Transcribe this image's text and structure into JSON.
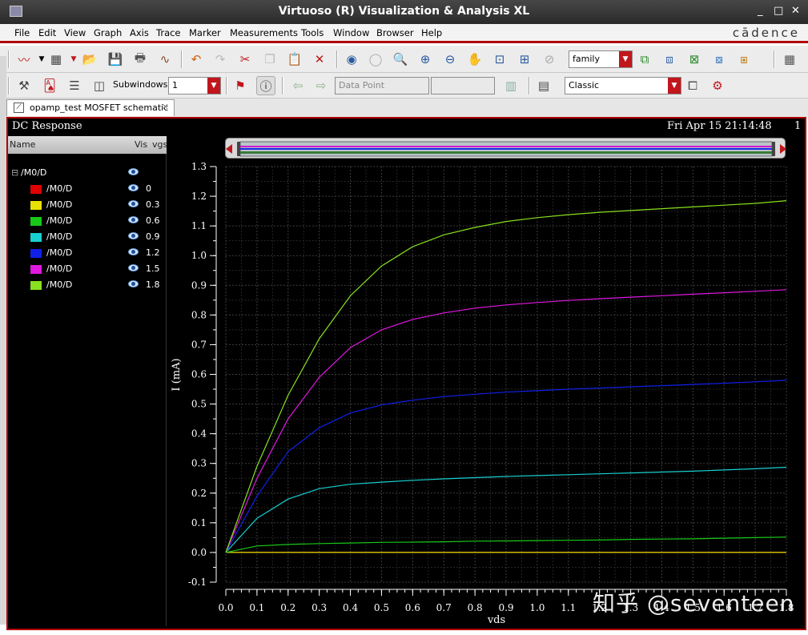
{
  "window": {
    "title": "Virtuoso (R) Visualization & Analysis XL",
    "brand": "cādence"
  },
  "menu": [
    "File",
    "Edit",
    "View",
    "Graph",
    "Axis",
    "Trace",
    "Marker",
    "Measurements",
    "Tools",
    "Window",
    "Browser",
    "Help"
  ],
  "toolbar": {
    "family_combo": "family",
    "subwindows_label": "Subwindows:",
    "subwindows_value": "1",
    "data_point_combo": "Data Point",
    "style_combo": "Classic"
  },
  "tab": {
    "label": "opamp_test MOSFET schematic"
  },
  "graph": {
    "header_title": "DC Response",
    "header_date": "Fri Apr 15 21:14:48",
    "subwindow_number": "1",
    "watermark": "知乎 @seventeen"
  },
  "legend": {
    "columns": [
      "Name",
      "Vis",
      "vgs"
    ],
    "group": "/M0/D",
    "rows": [
      {
        "name": "/M0/D",
        "vgs": "0",
        "color": "#e00000"
      },
      {
        "name": "/M0/D",
        "vgs": "0.3",
        "color": "#e8e000"
      },
      {
        "name": "/M0/D",
        "vgs": "0.6",
        "color": "#18c818"
      },
      {
        "name": "/M0/D",
        "vgs": "0.9",
        "color": "#18d0d0"
      },
      {
        "name": "/M0/D",
        "vgs": "1.2",
        "color": "#1020e8"
      },
      {
        "name": "/M0/D",
        "vgs": "1.5",
        "color": "#e018e0"
      },
      {
        "name": "/M0/D",
        "vgs": "1.8",
        "color": "#88e020"
      }
    ]
  },
  "chart_data": {
    "type": "line",
    "xlabel": "vds",
    "ylabel": "I (mA)",
    "xlim": [
      0,
      1.8
    ],
    "ylim": [
      -0.1,
      1.3
    ],
    "xticks": [
      "0.0",
      "0.1",
      "0.2",
      "0.3",
      "0.4",
      "0.5",
      "0.6",
      "0.7",
      "0.8",
      "0.9",
      "1.0",
      "1.1",
      "1.2",
      "1.3",
      "1.4",
      "1.5",
      "1.6",
      "1.7",
      "1.8"
    ],
    "yticks": [
      "-0.1",
      "0.0",
      "0.1",
      "0.2",
      "0.3",
      "0.4",
      "0.5",
      "0.6",
      "0.7",
      "0.8",
      "0.9",
      "1.0",
      "1.1",
      "1.2",
      "1.3"
    ],
    "grid": true,
    "x": [
      0,
      0.1,
      0.2,
      0.3,
      0.4,
      0.5,
      0.6,
      0.7,
      0.8,
      0.9,
      1.0,
      1.1,
      1.2,
      1.3,
      1.4,
      1.5,
      1.6,
      1.7,
      1.8
    ],
    "series": [
      {
        "name": "0",
        "color": "#e00000",
        "values": [
          0,
          0,
          0,
          0,
          0,
          0,
          0,
          0,
          0,
          0,
          0,
          0,
          0,
          0,
          0,
          0,
          0,
          0,
          0
        ]
      },
      {
        "name": "0.3",
        "color": "#e8e000",
        "values": [
          0,
          0,
          0,
          0,
          0,
          0,
          0,
          0,
          0,
          0,
          0,
          0,
          0,
          0,
          0,
          0,
          0,
          0,
          0
        ]
      },
      {
        "name": "0.6",
        "color": "#18c818",
        "values": [
          0,
          0.022,
          0.027,
          0.03,
          0.032,
          0.034,
          0.035,
          0.036,
          0.038,
          0.039,
          0.04,
          0.041,
          0.042,
          0.044,
          0.045,
          0.046,
          0.048,
          0.05,
          0.052
        ]
      },
      {
        "name": "0.9",
        "color": "#18d0d0",
        "values": [
          0,
          0.115,
          0.18,
          0.215,
          0.23,
          0.237,
          0.243,
          0.248,
          0.252,
          0.256,
          0.259,
          0.262,
          0.265,
          0.268,
          0.271,
          0.274,
          0.278,
          0.282,
          0.287
        ]
      },
      {
        "name": "1.2",
        "color": "#1020e8",
        "values": [
          0,
          0.19,
          0.34,
          0.42,
          0.47,
          0.497,
          0.513,
          0.525,
          0.533,
          0.54,
          0.545,
          0.55,
          0.554,
          0.558,
          0.562,
          0.566,
          0.57,
          0.575,
          0.58
        ]
      },
      {
        "name": "1.5",
        "color": "#e018e0",
        "values": [
          0,
          0.25,
          0.45,
          0.59,
          0.69,
          0.75,
          0.785,
          0.807,
          0.823,
          0.834,
          0.842,
          0.849,
          0.855,
          0.86,
          0.865,
          0.87,
          0.875,
          0.88,
          0.885
        ]
      },
      {
        "name": "1.8",
        "color": "#88e020",
        "values": [
          0,
          0.29,
          0.53,
          0.72,
          0.865,
          0.965,
          1.03,
          1.07,
          1.095,
          1.115,
          1.128,
          1.138,
          1.146,
          1.152,
          1.158,
          1.164,
          1.17,
          1.176,
          1.185
        ]
      }
    ]
  }
}
